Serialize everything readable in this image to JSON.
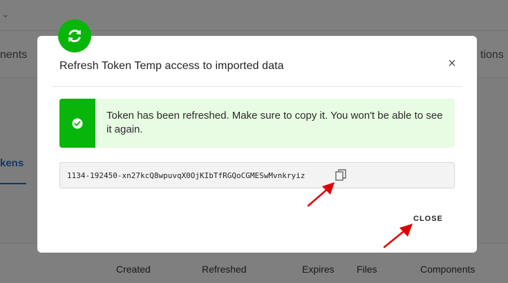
{
  "background": {
    "tabs": [
      "nents",
      "tions"
    ],
    "subtab": "kens",
    "columns": [
      "Created",
      "Refreshed",
      "Expires",
      "Files",
      "Components"
    ]
  },
  "modal": {
    "title": "Refresh Token Temp access to imported data",
    "close_x": "×",
    "alert_text": "Token has been refreshed. Make sure to copy it. You won't be able to see it again.",
    "token": "1134-192450-xn27kcQ8wpuvqX0OjKIbTfRGQoCGMESwMvnkryiz",
    "close_label": "CLOSE",
    "icons": {
      "header": "refresh-icon",
      "alert": "check-circle-icon",
      "copy": "copy-icon",
      "close": "close-icon"
    }
  },
  "colors": {
    "success": "#08b50a",
    "alert_bg": "#e8fbe3",
    "annotation_arrow": "#e00000"
  }
}
